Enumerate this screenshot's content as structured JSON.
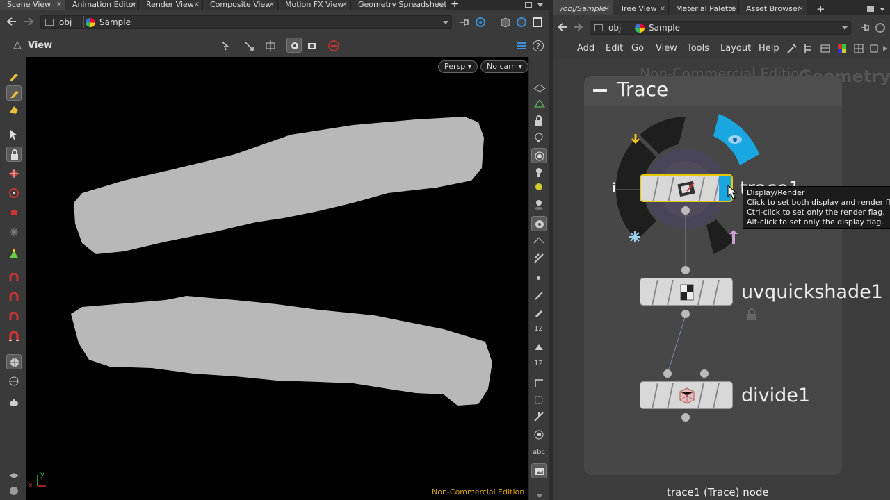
{
  "left_tabs": [
    {
      "label": "Scene View",
      "close": "×"
    },
    {
      "label": "Animation Editor",
      "close": "×"
    },
    {
      "label": "Render View",
      "close": "×"
    },
    {
      "label": "Composite View",
      "close": "×"
    },
    {
      "label": "Motion FX View",
      "close": "×"
    },
    {
      "label": "Geometry Spreadsheet",
      "close": "×"
    }
  ],
  "right_tabs": [
    {
      "label": "/obj/Sample",
      "close": "×"
    },
    {
      "label": "Tree View",
      "close": "×"
    },
    {
      "label": "Material Palette",
      "close": "×"
    },
    {
      "label": "Asset Browser",
      "close": "×"
    }
  ],
  "add_tab": "+",
  "left_path": {
    "obj": "obj",
    "node": "Sample"
  },
  "right_path": {
    "obj": "obj",
    "node": "Sample"
  },
  "viewer": {
    "label": "View",
    "persp_button": "Persp",
    "cam_button": "No cam",
    "watermark": "Non-Commercial Edition",
    "axis_y": "y",
    "axis_x": "x"
  },
  "right_toolbar_labels": {
    "twelve_a": "12",
    "twelve_b": "12",
    "abc": "abc"
  },
  "menu": [
    "Add",
    "Edit",
    "Go",
    "View",
    "Tools",
    "Layout",
    "Help"
  ],
  "network": {
    "watermark_left": "Non-Commercial Edition",
    "watermark_right": "Geometry",
    "subnet_title": "Trace",
    "nodes": [
      {
        "name": "trace1"
      },
      {
        "name": "uvquickshade1"
      },
      {
        "name": "divide1"
      }
    ],
    "status": "trace1 (Trace) node"
  },
  "tooltip": {
    "title": "Display/Render",
    "line1": "Click to set both display and render flag",
    "line2": "Ctrl-click to set only the render flag.",
    "line3": "Alt-click to set only the display flag."
  },
  "colors": {
    "display_flag": "#1aa6e0",
    "selected_outline": "#e8c800",
    "watermark_text": "#d4a000"
  }
}
